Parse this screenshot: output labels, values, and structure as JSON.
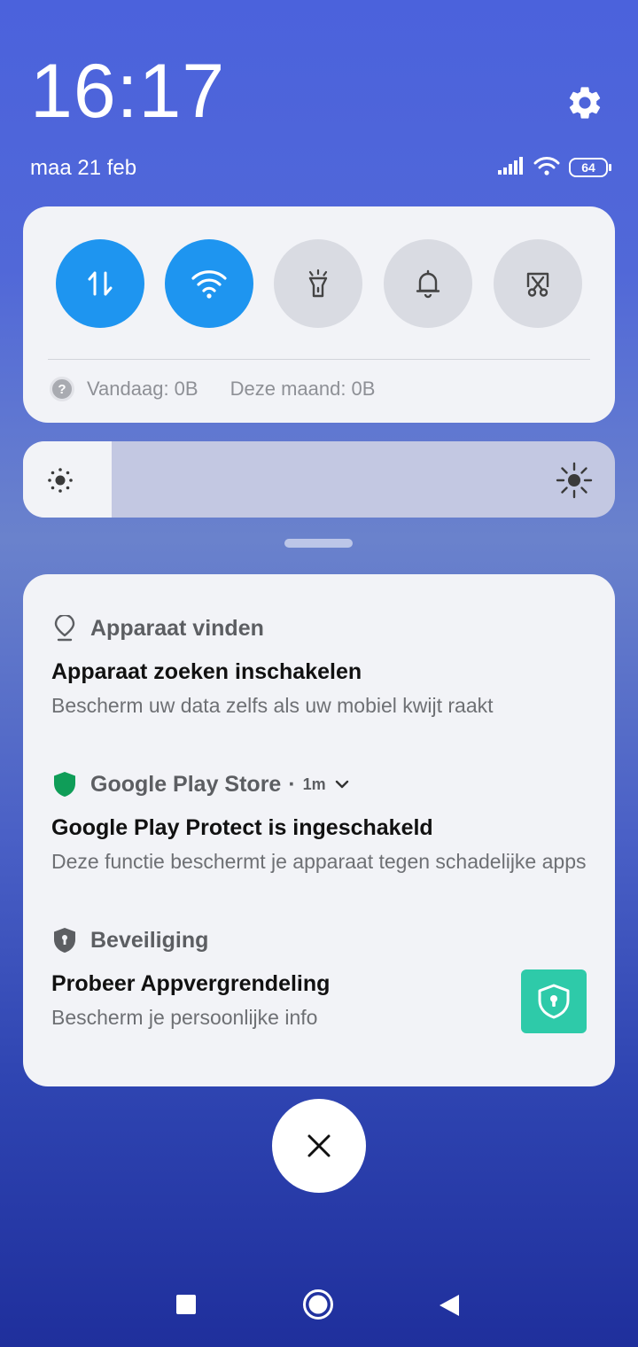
{
  "status_bar": {
    "time": "16:17",
    "date": "maa 21 feb",
    "battery_level": "64"
  },
  "quick_settings": {
    "tiles": [
      {
        "name": "mobile-data",
        "active": true
      },
      {
        "name": "wifi",
        "active": true
      },
      {
        "name": "flashlight",
        "active": false
      },
      {
        "name": "ringer",
        "active": false
      },
      {
        "name": "screenshot",
        "active": false
      }
    ],
    "usage_today": "Vandaag: 0B",
    "usage_month": "Deze maand: 0B"
  },
  "brightness": {
    "level": 0.15
  },
  "notifications": [
    {
      "app": "Apparaat vinden",
      "icon": "location-pin-icon",
      "title": "Apparaat zoeken inschakelen",
      "body": "Bescherm uw data zelfs als uw mobiel kwijt raakt"
    },
    {
      "app": "Google Play Store",
      "icon": "shield-icon",
      "separator": "·",
      "age": "1m",
      "title": "Google Play Protect is ingeschakeld",
      "body": "Deze functie beschermt je apparaat tegen schadelijke apps"
    },
    {
      "app": "Beveiliging",
      "icon": "security-shield-icon",
      "title": "Probeer Appvergrendeling",
      "body": "Bescherm je persoonlijke info"
    }
  ],
  "colors": {
    "tile_active": "#1e95f0",
    "tile_inactive": "#d9dbe2",
    "play_protect_green": "#0f9d58",
    "applock_teal": "#2ecaa9"
  }
}
